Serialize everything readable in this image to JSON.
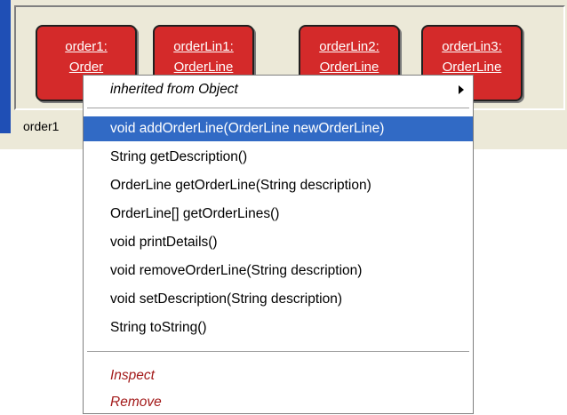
{
  "bench": {
    "objects": [
      {
        "name": "order1:",
        "type": "Order"
      },
      {
        "name": "orderLin1:",
        "type": "OrderLine"
      },
      {
        "name": "orderLin2:",
        "type": "OrderLine"
      },
      {
        "name": "orderLin3:",
        "type": "OrderLine"
      }
    ],
    "status": "order1"
  },
  "menu": {
    "inherited_label": "inherited from Object",
    "methods": [
      "void addOrderLine(OrderLine newOrderLine)",
      "String getDescription()",
      "OrderLine getOrderLine(String description)",
      "OrderLine[] getOrderLines()",
      "void printDetails()",
      "void removeOrderLine(String description)",
      "void setDescription(String description)",
      "String toString()"
    ],
    "inspect_label": "Inspect",
    "remove_label": "Remove"
  }
}
